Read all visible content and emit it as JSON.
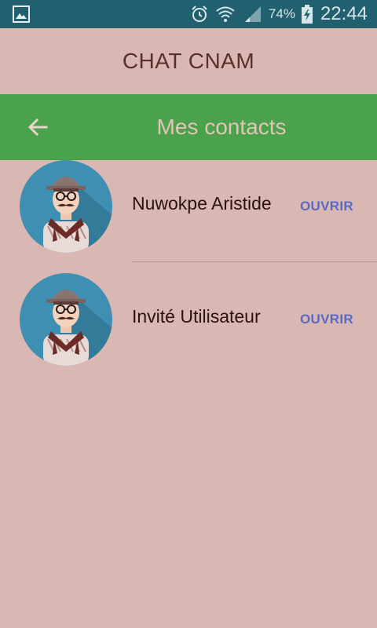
{
  "status_bar": {
    "battery_percent": "74%",
    "time": "22:44",
    "icons": [
      "image-icon",
      "alarm-icon",
      "wifi-icon",
      "signal-icon",
      "battery-charging-icon"
    ],
    "background": "#21606e"
  },
  "app": {
    "title": "CHAT CNAM"
  },
  "toolbar": {
    "title": "Mes contacts",
    "back_icon": "arrow-left-icon",
    "color": "#4aa34c"
  },
  "contacts": [
    {
      "name": "Nuwokpe Aristide",
      "action": "OUVRIR",
      "avatar_icon": "hipster-avatar-icon"
    },
    {
      "name": "Invité Utilisateur",
      "action": "OUVRIR",
      "avatar_icon": "hipster-avatar-icon"
    }
  ],
  "colors": {
    "background": "#d9b8b4",
    "accent": "#5a6ac0"
  }
}
